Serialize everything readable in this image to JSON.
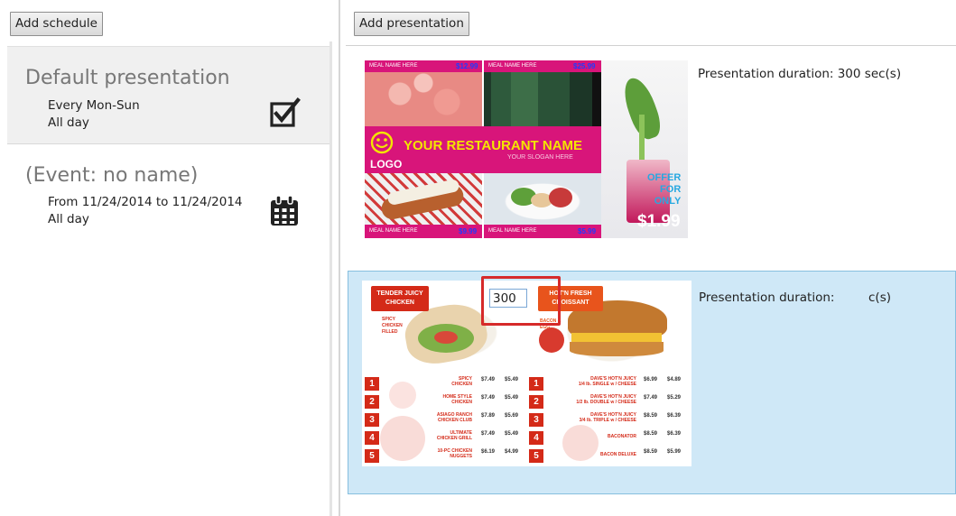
{
  "schedules": {
    "add_label": "Add schedule",
    "items": [
      {
        "title": "Default presentation",
        "line1": "Every Mon-Sun",
        "line2": "All day",
        "icon": "checkbox-checked-icon"
      },
      {
        "title": "(Event: no name)",
        "line1": "From 11/24/2014 to 11/24/2014",
        "line2": "All day",
        "icon": "calendar-icon"
      }
    ]
  },
  "presentations": {
    "add_label": "Add presentation",
    "items": [
      {
        "duration_text": "Presentation duration: 300 sec(s)",
        "thumb": {
          "meal_labels": [
            "MEAL NAME HERE",
            "MEAL NAME HERE",
            "MEAL NAME HERE",
            "MEAL NAME HERE"
          ],
          "prices": [
            "$12.99",
            "$25.99",
            "$9.99",
            "$5.99"
          ],
          "restaurant_name": "YOUR RESTAURANT NAME",
          "slogan": "YOUR SLOGAN HERE",
          "logo": "LOGO",
          "offer": [
            "OFFER",
            "FOR",
            "ONLY"
          ],
          "offer_price": "$1.99"
        }
      },
      {
        "duration_prefix": "Presentation duration:",
        "duration_value": "300",
        "duration_suffix": "c(s)",
        "thumb": {
          "header_left": [
            "TENDER JUICY",
            "CHICKEN"
          ],
          "header_right": [
            "HOT'N FRESH",
            "CROISSANT"
          ],
          "spicy_note": [
            "SPICY",
            "CHICKEN",
            "FILLED"
          ],
          "bacon_note": [
            "BACON &",
            "EGG"
          ],
          "left_items": [
            {
              "num": "1",
              "name": [
                "SPICY",
                "CHICKEN"
              ],
              "p1": "$7.49",
              "p2": "$5.49"
            },
            {
              "num": "2",
              "name": [
                "HOME STYLE",
                "CHICKEN"
              ],
              "p1": "$7.49",
              "p2": "$5.49"
            },
            {
              "num": "3",
              "name": [
                "ASIAGO RANCH",
                "CHICKEN CLUB"
              ],
              "p1": "$7.89",
              "p2": "$5.69"
            },
            {
              "num": "4",
              "name": [
                "ULTIMATE",
                "CHICKEN GRILL"
              ],
              "p1": "$7.49",
              "p2": "$5.49"
            },
            {
              "num": "5",
              "name": [
                "10-PC CHICKEN",
                "NUGGETS"
              ],
              "p1": "$6.19",
              "p2": "$4.99"
            }
          ],
          "right_items": [
            {
              "num": "1",
              "name": [
                "DAVE'S HOT'N JUICY",
                "1/4 lb. SINGLE w / CHEESE"
              ],
              "p1": "$6.99",
              "p2": "$4.89"
            },
            {
              "num": "2",
              "name": [
                "DAVE'S HOT'N JUICY",
                "1/2 lb. DOUBLE w / CHEESE"
              ],
              "p1": "$7.49",
              "p2": "$5.29"
            },
            {
              "num": "3",
              "name": [
                "DAVE'S HOT'N JUICY",
                "3/4 lb. TRIPLE w / CHEESE"
              ],
              "p1": "$8.59",
              "p2": "$6.39"
            },
            {
              "num": "4",
              "name": [
                "BACONATOR"
              ],
              "p1": "$8.59",
              "p2": "$6.39"
            },
            {
              "num": "5",
              "name": [
                "BACON DELUXE"
              ],
              "p1": "$8.59",
              "p2": "$5.99"
            }
          ]
        }
      }
    ]
  },
  "colors": {
    "selection_blue": "#cfe8f7",
    "highlight_red": "#d62a2a",
    "menu_red": "#d42a18",
    "restaurant_pink": "#d8157a"
  }
}
